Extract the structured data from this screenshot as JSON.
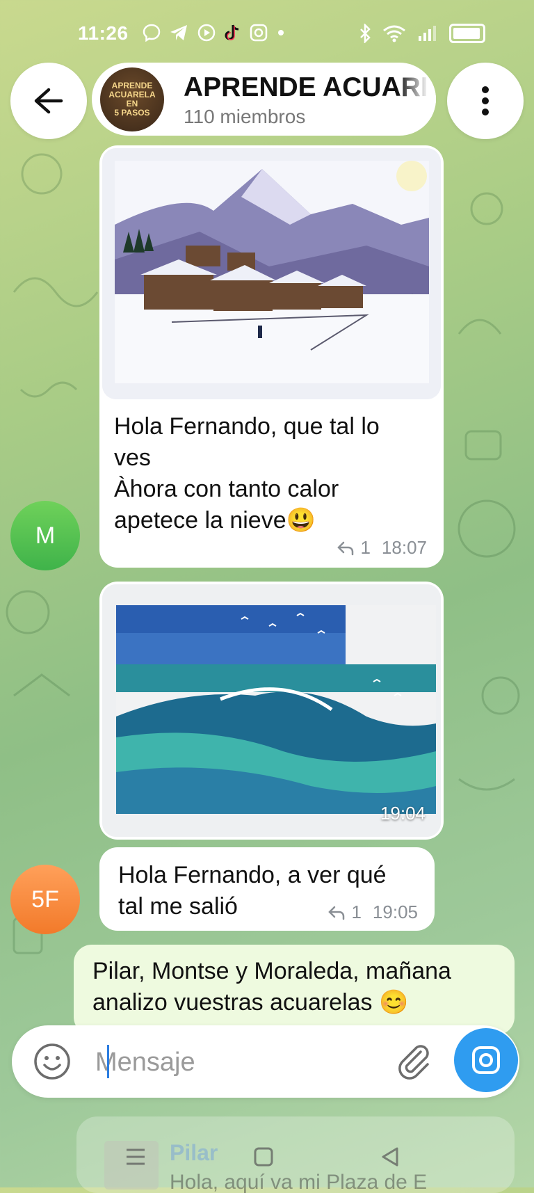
{
  "status_bar": {
    "time": "11:26",
    "left_icons": [
      "facebook-messenger-icon",
      "telegram-icon",
      "youtube-icon",
      "tiktok-icon",
      "instagram-icon",
      "dot-icon"
    ],
    "right_icons": [
      "bluetooth-icon",
      "wifi-icon",
      "signal-icon",
      "battery-icon"
    ]
  },
  "header": {
    "group_name": "APRENDE ACUARELA EN 5 PASOS",
    "visible_title": "APRENDE ACUARI",
    "members": "110 miembros",
    "avatar_lines": [
      "APRENDE",
      "ACUARELA",
      "EN",
      "5 PASOS"
    ]
  },
  "messages": [
    {
      "sender_initial": "M",
      "avatar_color": "#4fc04f",
      "has_photo": true,
      "photo_desc": "snowy-mountain-village-watercolor",
      "text_lines": [
        "Hola Fernando, que tal lo",
        "ves",
        "Àhora con tanto calor",
        "apetece la nieve😃"
      ],
      "replies": "1",
      "time": "18:07"
    },
    {
      "has_photo": true,
      "photo_desc": "ocean-wave-watercolor",
      "photo_time": "19:04"
    },
    {
      "sender_initial": "5F",
      "avatar_color": "#f5873b",
      "text_lines": [
        "Hola Fernando, a ver qué",
        "tal me salió"
      ],
      "replies": "1",
      "time": "19:05"
    },
    {
      "own": true,
      "text_lines": [
        "Pilar, Montse y Moraleda, mañana",
        "analizo vuestras acuarelas 😊"
      ]
    }
  ],
  "composer": {
    "placeholder": "Mensaje",
    "emoji_icon": "smiley-icon",
    "attach_icon": "paperclip-icon",
    "camera_icon": "camera-icon"
  },
  "pinned": {
    "name": "Pilar",
    "text": "Hola, aquí va mi Plaza de E"
  },
  "colors": {
    "accent": "#2f9cf0",
    "own_bubble": "#eefadf",
    "avatar_m": "#4fc04f",
    "avatar_5f": "#f5873b"
  }
}
